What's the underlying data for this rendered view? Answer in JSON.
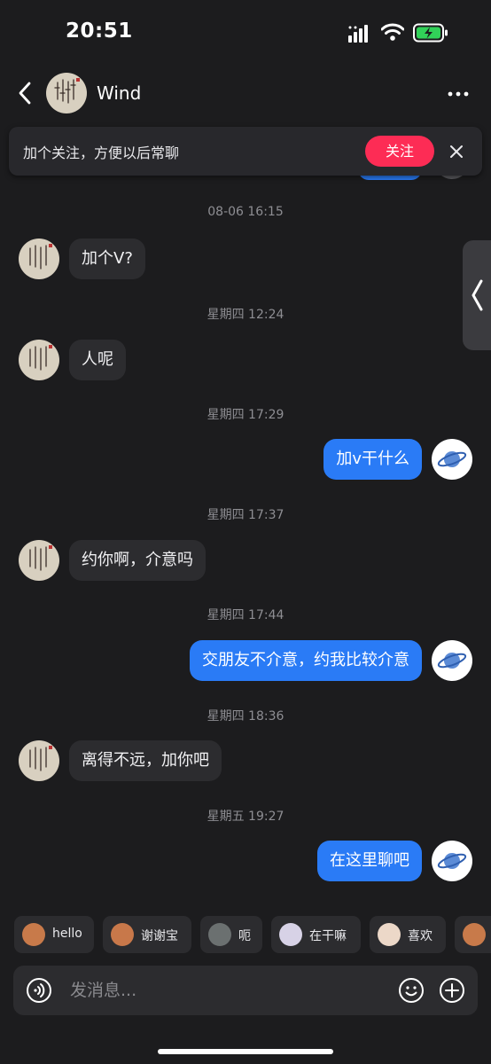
{
  "status": {
    "time": "20:51"
  },
  "header": {
    "contact_name": "Wind"
  },
  "follow_banner": {
    "text": "加个关注，方便以后常聊",
    "button": "关注"
  },
  "messages": [
    {
      "type": "time",
      "text": "08-06 16:15"
    },
    {
      "type": "in",
      "text": "加个V?"
    },
    {
      "type": "time",
      "text": "星期四 12:24"
    },
    {
      "type": "in",
      "text": "人呢"
    },
    {
      "type": "time",
      "text": "星期四 17:29"
    },
    {
      "type": "out",
      "text": "加v干什么"
    },
    {
      "type": "time",
      "text": "星期四 17:37"
    },
    {
      "type": "in",
      "text": "约你啊，介意吗"
    },
    {
      "type": "time",
      "text": "星期四 17:44"
    },
    {
      "type": "out",
      "text": "交朋友不介意，约我比较介意"
    },
    {
      "type": "time",
      "text": "星期四 18:36"
    },
    {
      "type": "in",
      "text": "离得不远，加你吧"
    },
    {
      "type": "time",
      "text": "星期五 19:27"
    },
    {
      "type": "out",
      "text": "在这里聊吧"
    }
  ],
  "quick_replies": [
    "hello",
    "谢谢宝",
    "呃",
    "在干嘛",
    "喜欢"
  ],
  "input": {
    "placeholder": "发消息..."
  },
  "colors": {
    "accent_blue": "#2a7bf6",
    "follow_red": "#fd2c55",
    "background": "#1c1c1e",
    "bubble_in": "#2c2c2f"
  }
}
